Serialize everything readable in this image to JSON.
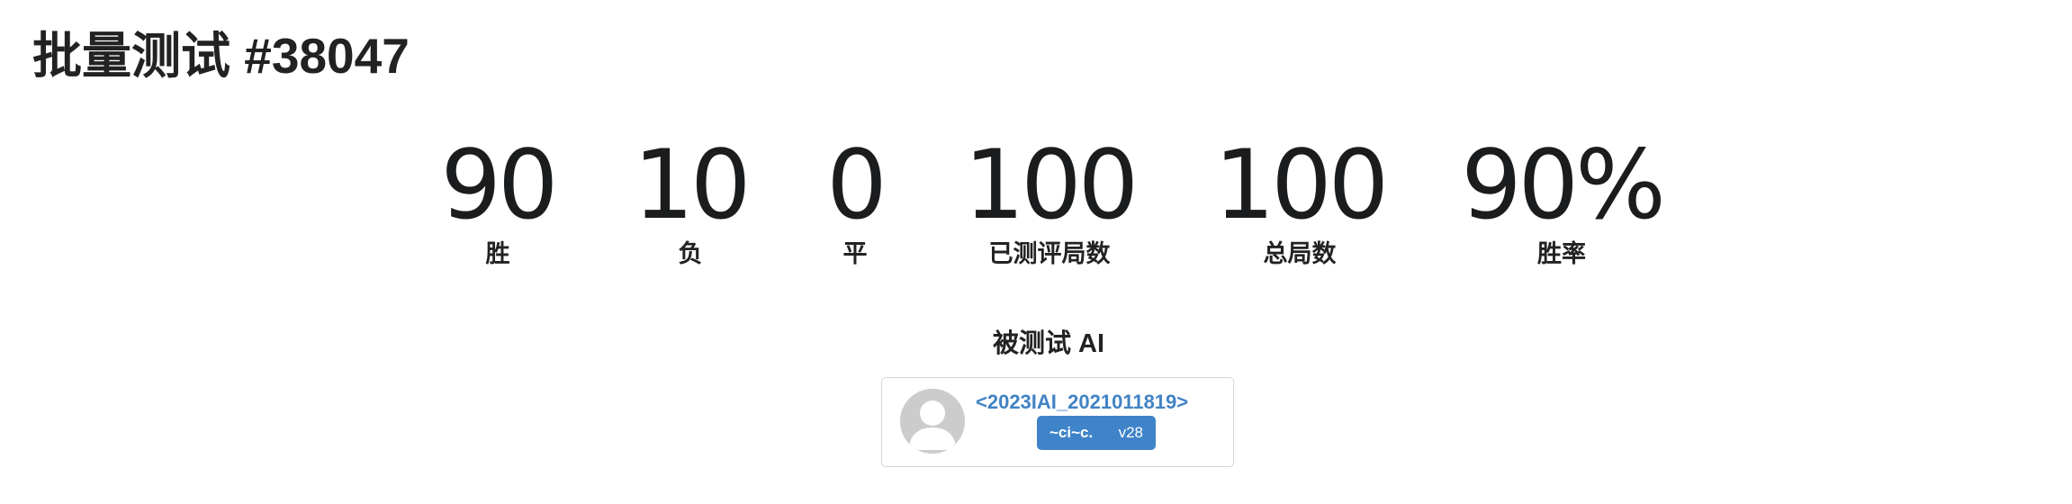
{
  "page": {
    "title": "批量测试 #38047"
  },
  "stats": [
    {
      "value": "90",
      "label": "胜"
    },
    {
      "value": "10",
      "label": "负"
    },
    {
      "value": "0",
      "label": "平"
    },
    {
      "value": "100",
      "label": "已测评局数"
    },
    {
      "value": "100",
      "label": "总局数"
    },
    {
      "value": "90%",
      "label": "胜率"
    }
  ],
  "tested_ai": {
    "section_title": "被测试 AI",
    "avatar_icon": "user-avatar-icon",
    "name": "<2023IAI_2021011819>",
    "tag_user": "~ci~c.",
    "tag_version": "v28",
    "colors": {
      "link": "#4183c4",
      "tag_background": "#3f84c9"
    }
  }
}
